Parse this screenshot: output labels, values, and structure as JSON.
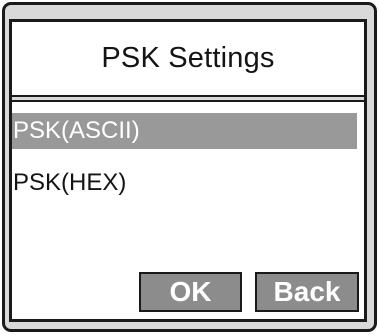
{
  "dialog": {
    "title": "PSK Settings"
  },
  "menu": {
    "items": [
      {
        "label": "PSK(ASCII)",
        "selected": true
      },
      {
        "label": "PSK(HEX)",
        "selected": false
      }
    ]
  },
  "buttons": {
    "ok_label": "OK",
    "back_label": "Back"
  },
  "colors": {
    "selection_bg": "#999999",
    "button_bg": "#8c8c8c",
    "frame_bg": "#d9d9d9",
    "screen_bg": "#ffffff"
  }
}
